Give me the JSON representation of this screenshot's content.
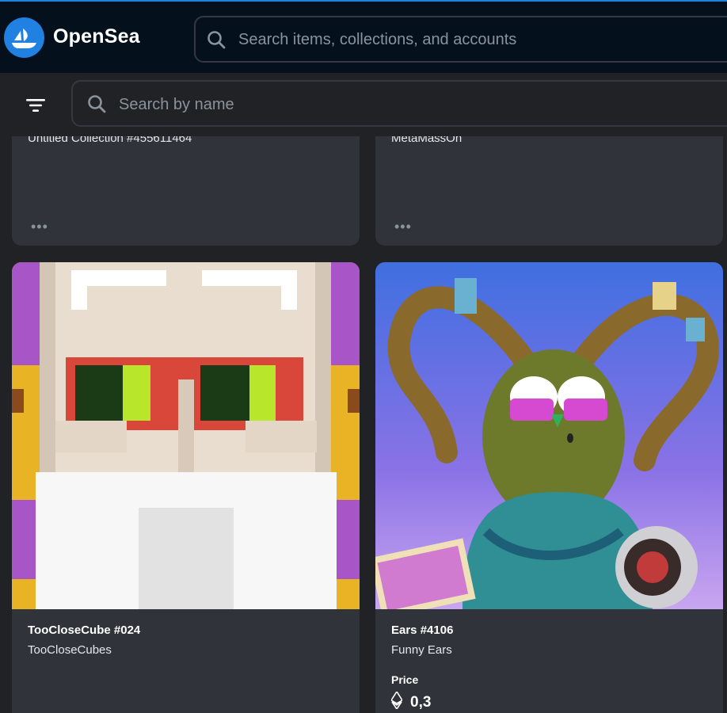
{
  "header": {
    "brand": "OpenSea",
    "search_placeholder": "Search items, collections, and accounts"
  },
  "toolbar": {
    "name_search_placeholder": "Search by name"
  },
  "cards_top": [
    {
      "collection": "Untitled Collection #455611464",
      "more": "•••"
    },
    {
      "collection": "MetaMassOn",
      "more": "•••"
    }
  ],
  "cards": [
    {
      "title": "TooCloseCube #024",
      "collection": "TooCloseCubes"
    },
    {
      "title": "Ears #4106",
      "collection": "Funny Ears",
      "price_label": "Price",
      "price": "0,3"
    }
  ],
  "colors": {
    "accent": "#2081e2",
    "header_bg": "#04111d",
    "card_bg": "#303339",
    "page_bg": "#202226"
  }
}
